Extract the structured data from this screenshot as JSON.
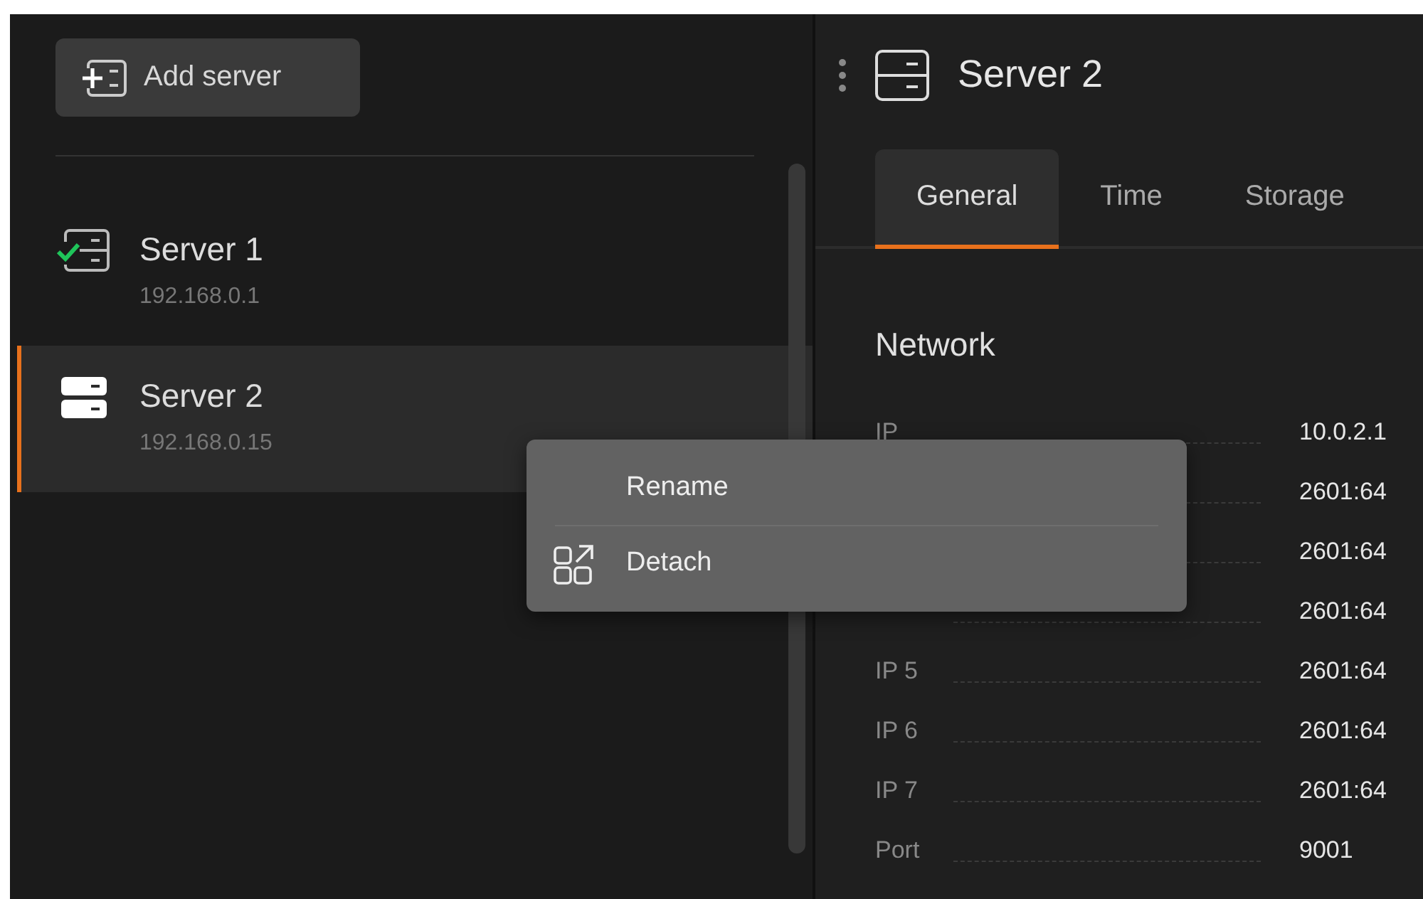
{
  "add_button": {
    "label": "Add server"
  },
  "servers": [
    {
      "name": "Server 1",
      "address": "192.168.0.1",
      "connected": true,
      "selected": false
    },
    {
      "name": "Server 2",
      "address": "192.168.0.15",
      "connected": false,
      "selected": true
    }
  ],
  "detail": {
    "title": "Server 2",
    "tabs": [
      {
        "label": "General",
        "selected": true
      },
      {
        "label": "Time",
        "selected": false
      },
      {
        "label": "Storage",
        "selected": false
      }
    ],
    "section": "Network",
    "rows": [
      {
        "label": "IP",
        "value": "10.0.2.1"
      },
      {
        "value": "2601:64"
      },
      {
        "value": "2601:64"
      },
      {
        "value": "2601:64"
      },
      {
        "label": "IP 5",
        "value": "2601:64"
      },
      {
        "label": "IP 6",
        "value": "2601:64"
      },
      {
        "label": "IP 7",
        "value": "2601:64"
      },
      {
        "label": "Port",
        "value": "9001"
      }
    ]
  },
  "context_menu": {
    "items": [
      {
        "label": "Rename",
        "kind": "plain"
      },
      {
        "label": "Detach",
        "kind": "iconic"
      }
    ]
  }
}
